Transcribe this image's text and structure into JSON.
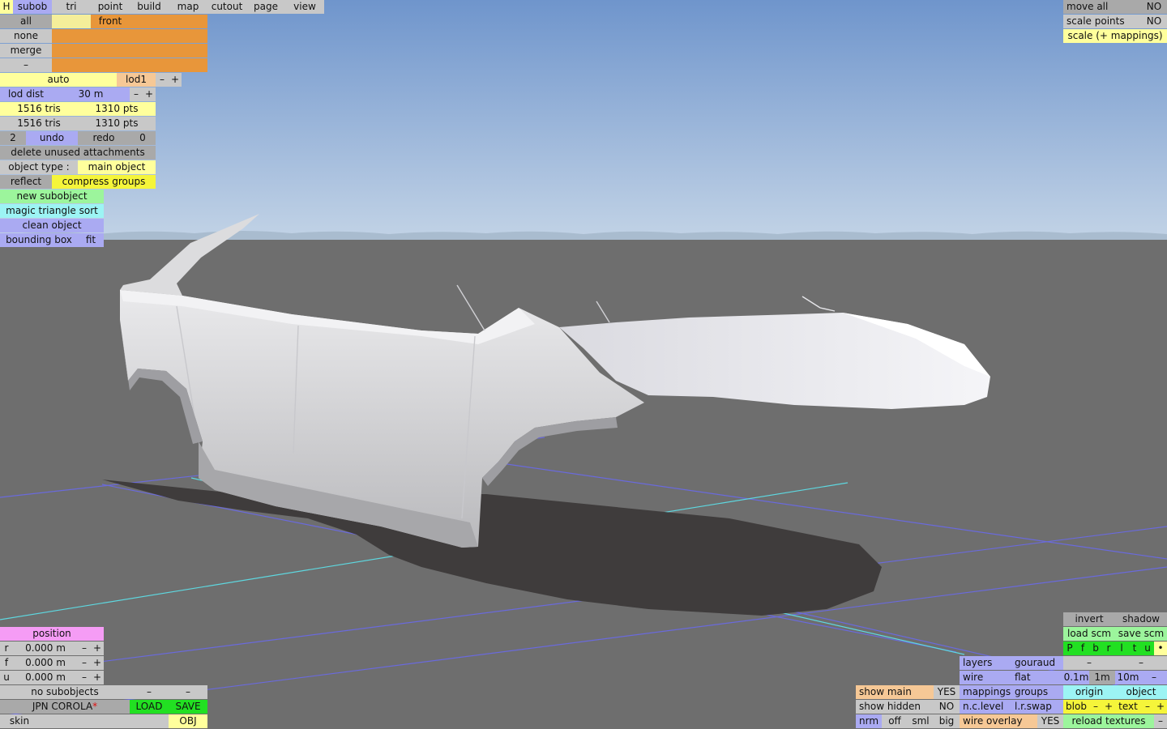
{
  "menu": {
    "h": "H",
    "tabs": [
      "subob",
      "tri",
      "point",
      "build",
      "map",
      "cutout",
      "page",
      "view"
    ]
  },
  "selection": {
    "rows": [
      "all",
      "none",
      "merge",
      "–"
    ],
    "front": "front"
  },
  "lod": {
    "auto": "auto",
    "name": "lod1",
    "minus": "–",
    "plus": "+",
    "dist_label": "lod dist",
    "dist_value": "30 m"
  },
  "stats": {
    "tris1": "1516 tris",
    "pts1": "1310 pts",
    "tris2": "1516 tris",
    "pts2": "1310 pts"
  },
  "history": {
    "undo_count": "2",
    "undo": "undo",
    "redo": "redo",
    "redo_count": "0"
  },
  "actions": {
    "delete_unused": "delete unused attachments",
    "object_type_label": "object type :",
    "object_type_value": "main object",
    "reflect": "reflect",
    "compress_groups": "compress groups",
    "new_subobject": "new subobject",
    "magic_sort": "magic triangle sort",
    "clean_object": "clean object",
    "bounding_box": "bounding box",
    "fit": "fit"
  },
  "top_right": {
    "move_all": "move all",
    "move_all_value": "NO",
    "scale_points": "scale points",
    "scale_points_value": "NO",
    "scale_mappings": "scale (+ mappings)"
  },
  "position": {
    "title": "position",
    "rows": [
      {
        "axis": "r",
        "value": "0.000 m"
      },
      {
        "axis": "f",
        "value": "0.000 m"
      },
      {
        "axis": "u",
        "value": "0.000 m"
      }
    ],
    "minus": "–",
    "plus": "+"
  },
  "bottom_left": {
    "no_subobjects": "no subobjects",
    "dash1": "–",
    "dash2": "–",
    "file_name": "JPN COROLA",
    "modified_mark": "*",
    "load": "LOAD",
    "save": "SAVE",
    "skin": "skin",
    "obj": "OBJ"
  },
  "bottom_right": {
    "show_main": "show main",
    "show_main_value": "YES",
    "show_hidden": "show hidden",
    "show_hidden_value": "NO",
    "nrm": "nrm",
    "off": "off",
    "sml": "sml",
    "big": "big",
    "layers": "layers",
    "gouraud": "gouraud",
    "wire": "wire",
    "flat": "flat",
    "mappings": "mappings",
    "groups": "groups",
    "nc_level": "n.c.level",
    "lr_swap": "l.r.swap",
    "wire_overlay": "wire overlay",
    "wire_overlay_value": "YES",
    "invert": "invert",
    "shadow": "shadow",
    "load_scm": "load scm",
    "save_scm": "save scm",
    "view_letters": [
      "P",
      "f",
      "b",
      "r",
      "l",
      "t",
      "u",
      "•"
    ],
    "dash_a": "–",
    "dash_b": "–",
    "grid_01": "0.1m",
    "grid_1": "1m",
    "grid_10": "10m",
    "grid_minus": "–",
    "origin": "origin",
    "object": "object",
    "blob": "blob",
    "blob_minus": "–",
    "blob_plus": "+",
    "text": "text",
    "text_minus": "–",
    "text_plus": "+",
    "reload_textures": "reload textures",
    "reload_minus": "–"
  },
  "colors": {
    "sky_top": "#7a9fd0",
    "sky_bottom": "#b7cde4",
    "ground": "#6e6e6e",
    "body": "#e2e2e4",
    "shadow": "#3f3c3c",
    "grid_blue": "#6a6adc",
    "grid_cyan": "#5ed8e0"
  }
}
